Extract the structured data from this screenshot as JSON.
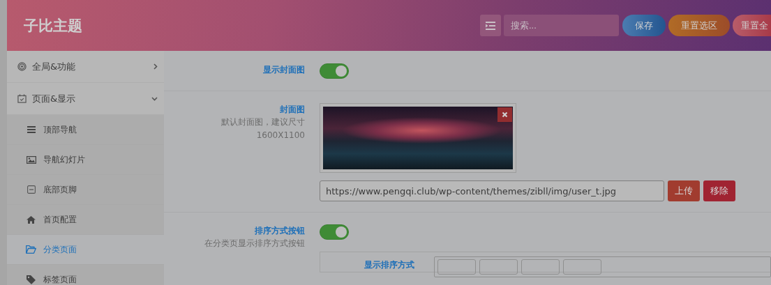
{
  "header": {
    "title": "子比主题",
    "search": {
      "placeholder": "搜索..."
    },
    "buttons": [
      {
        "label": "保存",
        "kind": "save"
      },
      {
        "label": "重置选区",
        "kind": "reset-section"
      },
      {
        "label": "重置全",
        "kind": "reset-all"
      }
    ]
  },
  "sidebar": {
    "items": [
      {
        "label": "全局&功能",
        "expanded": false
      },
      {
        "label": "页面&显示",
        "expanded": true,
        "children": [
          {
            "label": "顶部导航",
            "selected": false
          },
          {
            "label": "导航幻灯片",
            "selected": false
          },
          {
            "label": "底部页脚",
            "selected": false
          },
          {
            "label": "首页配置",
            "selected": false
          },
          {
            "label": "分类页面",
            "selected": true
          },
          {
            "label": "标签页面",
            "selected": false
          }
        ]
      }
    ]
  },
  "settings": [
    {
      "kind": "switch",
      "label": "显示封面图",
      "on": true
    },
    {
      "kind": "image",
      "label": "封面图",
      "description": "默认封面图，建议尺寸1600X1100",
      "value": "https://www.pengqi.club/wp-content/themes/zibll/img/user_t.jpg",
      "buttons": [
        "上传",
        "移除"
      ]
    },
    {
      "kind": "switch",
      "label": "排序方式按钮",
      "description": "在分类页显示排序方式按钮",
      "on": true,
      "nested": {
        "label": "显示排序方式"
      }
    }
  ]
}
